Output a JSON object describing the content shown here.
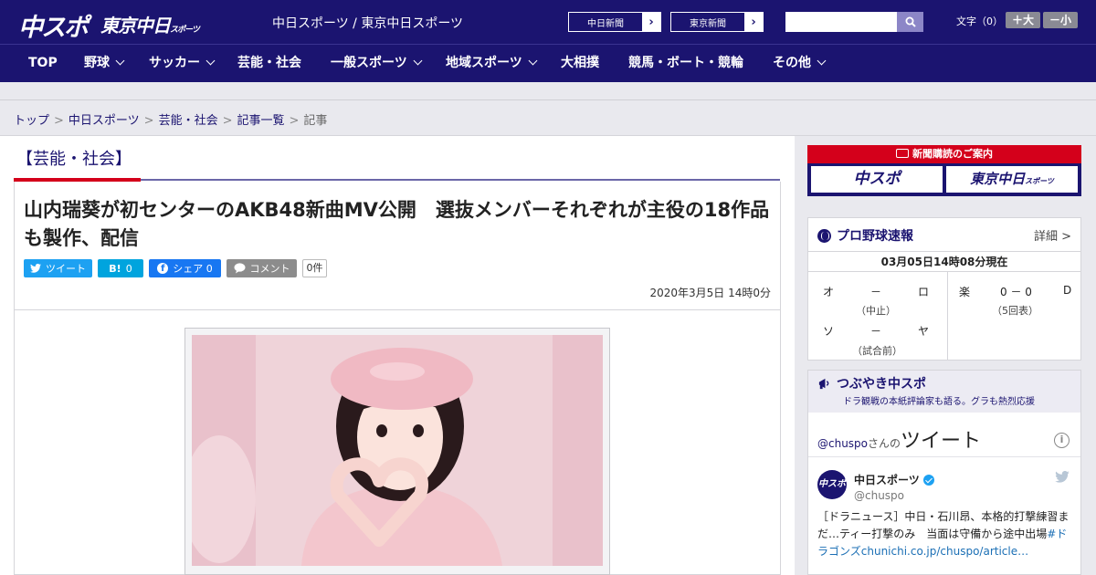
{
  "header": {
    "logo_main": "中スポ",
    "logo_tokyo": "東京中日",
    "logo_tokyo_sub": "スポーツ",
    "site_title": "中日スポーツ / 東京中日スポーツ",
    "link_chunichi": "中日新聞",
    "link_tokyo": "東京新聞",
    "search_placeholder": "",
    "fontsize_label": "文字（0）",
    "font_larger": "＋大",
    "font_smaller": "－小"
  },
  "nav": {
    "items": [
      {
        "label": "TOP"
      },
      {
        "label": "野球"
      },
      {
        "label": "サッカー"
      },
      {
        "label": "芸能・社会"
      },
      {
        "label": "一般スポーツ"
      },
      {
        "label": "地域スポーツ"
      },
      {
        "label": "大相撲"
      },
      {
        "label": "競馬・ボート・競輪"
      },
      {
        "label": "その他"
      }
    ]
  },
  "breadcrumb": {
    "items": [
      "トップ",
      "中日スポーツ",
      "芸能・社会",
      "記事一覧"
    ],
    "current": "記事"
  },
  "article": {
    "category": "【芸能・社会】",
    "title": "山内瑞葵が初センターのAKB48新曲MV公開　選抜メンバーそれぞれが主役の18作品も製作、配信",
    "share": {
      "tweet": "ツイート",
      "hatena_label": "B!",
      "hatena_count": "0",
      "facebook": "シェア 0",
      "comment": "コメント",
      "comment_count": "0件"
    },
    "date": "2020年3月5日 14時0分"
  },
  "sidebar": {
    "promo": {
      "header": "新聞購読のご案内",
      "btn_chuspo": "中スポ",
      "btn_tokyo": "東京中日",
      "btn_tokyo_sub": "スポーツ"
    },
    "baseball": {
      "title": "プロ野球速報",
      "detail": "詳細 >",
      "time": "03月05日14時08分現在",
      "games": [
        {
          "home": "オ",
          "score": "－",
          "away": "ロ",
          "note": "（中止）"
        },
        {
          "home": "ソ",
          "score": "－",
          "away": "ヤ",
          "note": "（試合前）"
        },
        {
          "home": "楽",
          "score": "0 － 0",
          "away": "D",
          "note": "（5回表）"
        }
      ]
    },
    "tweets": {
      "title": "つぶやき中スポ",
      "subtitle": "ドラ観戦の本紙評論家も語る。グラも熱烈応援",
      "handle": "@chuspo",
      "handle_suffix": "さんの",
      "heading": "ツイート",
      "account_name": "中日スポーツ",
      "account_handle": "@chuspo",
      "avatar_text": "中スポ",
      "text": "［ドラニュース］中日・石川昂、本格的打撃練習まだ…ティー打撃のみ　当面は守備から途中出場",
      "text_links": "#ドラゴンズchunichi.co.jp/chuspo/article…"
    }
  }
}
